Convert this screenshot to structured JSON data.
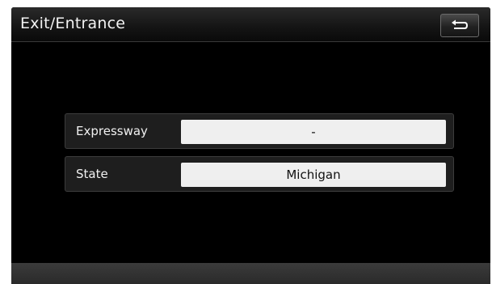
{
  "header": {
    "title": "Exit/Entrance",
    "back_icon": "return-arrow-icon"
  },
  "fields": [
    {
      "label": "Expressway",
      "value": "-"
    },
    {
      "label": "State",
      "value": "Michigan"
    }
  ],
  "colors": {
    "background": "#000000",
    "header_text": "#f2f2f2",
    "field_box": "#efefef",
    "footer": "#333333"
  }
}
